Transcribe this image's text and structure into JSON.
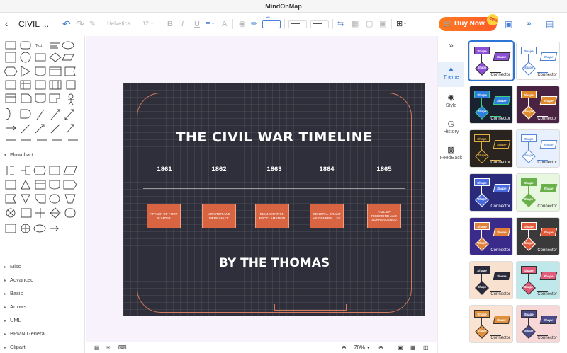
{
  "window": {
    "title": "MindOnMap"
  },
  "toolbar": {
    "doc_title": "CIVIL ...",
    "font_family": "Helvetica",
    "font_size": "12",
    "buy_label": "Buy Now",
    "discount_badge": "-60%"
  },
  "left_panel": {
    "text_shape_label": "Text",
    "categories": [
      "Flowchart",
      "Misc",
      "Advanced",
      "Basic",
      "Arrows",
      "UML",
      "BPMN General",
      "Clipart"
    ]
  },
  "canvas": {
    "title": "THE CIVIL WAR TIMELINE",
    "byline": "BY THE THOMAS",
    "years": [
      "1861",
      "1862",
      "1863",
      "1864",
      "1865"
    ],
    "events": [
      "ATTACK OF FORT SUMTER",
      "MONITOR AND MERRIMACK",
      "EMANCIPATION PROCLAMATION",
      "GENERAL GRANT VS GENERAL LEE",
      "FALL OF RICHMOND AND SURRENDERED"
    ],
    "colors": {
      "board": "#2e2f3a",
      "event_fill": "#d96441",
      "frame": "#d17a5c"
    }
  },
  "statusbar": {
    "zoom": "70%"
  },
  "side_tabs": [
    {
      "label": "Theme",
      "icon": "shirt-icon",
      "active": true
    },
    {
      "label": "Style",
      "icon": "palette-icon",
      "active": false
    },
    {
      "label": "History",
      "icon": "clock-icon",
      "active": false
    },
    {
      "label": "FeedBack",
      "icon": "chat-icon",
      "active": false
    }
  ],
  "themes": {
    "shape_label": "Shape",
    "connector_label": "Connector",
    "items": [
      {
        "bg": "#ffffff",
        "shape": "#8a4fd6",
        "text": "#ffffff",
        "line": "#333333",
        "cn": "#333333"
      },
      {
        "bg": "#ffffff",
        "shape": "#ffffff",
        "text": "#4a7fd6",
        "line": "#4a7fd6",
        "cn": "#333333"
      },
      {
        "bg": "#1a2232",
        "shape": "#2e7de0",
        "text": "#ffffff",
        "line": "#3ad07a",
        "cn": "#ffffff"
      },
      {
        "bg": "#4a2342",
        "shape": "#e08a2e",
        "text": "#ffffff",
        "line": "#ffffff",
        "cn": "#ffffff"
      },
      {
        "bg": "#2a2420",
        "shape": "#2a2420",
        "text": "#e0b040",
        "line": "#e0b040",
        "cn": "#ffffff"
      },
      {
        "bg": "#e7f0fc",
        "shape": "#ffffff",
        "text": "#5a8ad6",
        "line": "#5a8ad6",
        "cn": "#333333"
      },
      {
        "bg": "#2a2a7a",
        "shape": "#4a6ae0",
        "text": "#ffffff",
        "line": "#ffffff",
        "cn": "#ffffff"
      },
      {
        "bg": "#e8f7df",
        "shape": "#6ab04a",
        "text": "#ffffff",
        "line": "#6ab04a",
        "cn": "#333333"
      },
      {
        "bg": "#3a2a8a",
        "shape": "#e0803a",
        "text": "#ffffff",
        "line": "#ffffff",
        "cn": "#ffffff"
      },
      {
        "bg": "#3a3a3a",
        "shape": "#e05a3a",
        "text": "#ffffff",
        "line": "#ffffff",
        "cn": "#ffffff"
      },
      {
        "bg": "#f8e2cf",
        "shape": "#2a2a3a",
        "text": "#ffffff",
        "line": "#2a2a3a",
        "cn": "#333333"
      },
      {
        "bg": "#bfe8ea",
        "shape": "#e05a7a",
        "text": "#ffffff",
        "line": "#333333",
        "cn": "#333333"
      },
      {
        "bg": "#fbe3d3",
        "shape": "#e0903a",
        "text": "#ffffff",
        "line": "#333333",
        "cn": "#333333"
      },
      {
        "bg": "#f7d7d7",
        "shape": "#4a4a8a",
        "text": "#ffffff",
        "line": "#333333",
        "cn": "#333333"
      }
    ]
  }
}
